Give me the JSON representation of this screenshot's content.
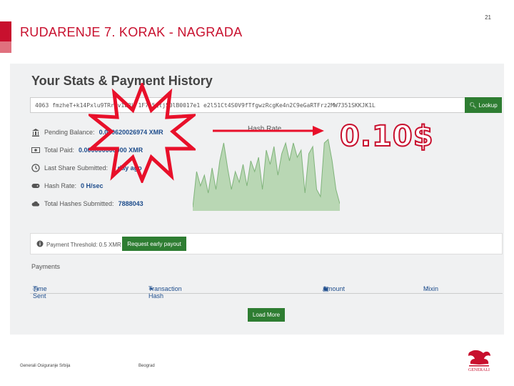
{
  "slide": {
    "number": "21",
    "title": "RUDARENJE 7. KORAK - NAGRADA",
    "footer_left": "Generali Osiguranje Srbija",
    "footer_mid": "Beograd",
    "big_amount": "0.10$",
    "brand_color": "#c8102e",
    "logo_text": "GENERALI"
  },
  "stats": {
    "title": "Your Stats & Payment History",
    "address": "4063 fmzheT+k14Pxlu9TRr+v1L2L 1F715Qtj50lB0017e1 e2l51Ct4S0V9fTfgwzRcgKe4n2C9eGaRTFrz2MW7351SKKJK1L",
    "lookup_label": "Lookup",
    "pending_label": "Pending Balance:",
    "pending_value": "0.000620026974 XMR",
    "paid_label": "Total Paid:",
    "paid_value": "0.000000000000 XMR",
    "last_share_label": "Last Share Submitted:",
    "last_share_value": "a day ago",
    "hash_rate_label": "Hash Rate:",
    "hash_rate_value": "0 H/sec",
    "total_hashes_label": "Total Hashes Submitted:",
    "total_hashes_value": "7888043",
    "chart_label": "Hash Rate"
  },
  "threshold": {
    "text": "Payment Threshold: 0.5 XMR",
    "early_label": "Request early payout"
  },
  "payments": {
    "title": "Payments",
    "columns": [
      "Time Sent",
      "Transaction Hash",
      "Amount",
      "Mixin"
    ],
    "load_more_label": "Load More"
  },
  "chart_data": {
    "type": "area",
    "title": "Hash Rate",
    "values": [
      0.05,
      0.55,
      0.35,
      0.5,
      0.25,
      0.6,
      0.3,
      0.7,
      0.95,
      0.6,
      0.3,
      0.55,
      0.4,
      0.65,
      0.35,
      0.7,
      0.55,
      0.75,
      0.3,
      0.85,
      0.65,
      0.9,
      0.5,
      0.8,
      0.95,
      0.7,
      0.95,
      0.75,
      0.85,
      0.25,
      0.8,
      0.9,
      0.3,
      0.2,
      0.95,
      1.0,
      0.7,
      0.3,
      0.1
    ],
    "ylim": [
      0,
      1
    ]
  }
}
